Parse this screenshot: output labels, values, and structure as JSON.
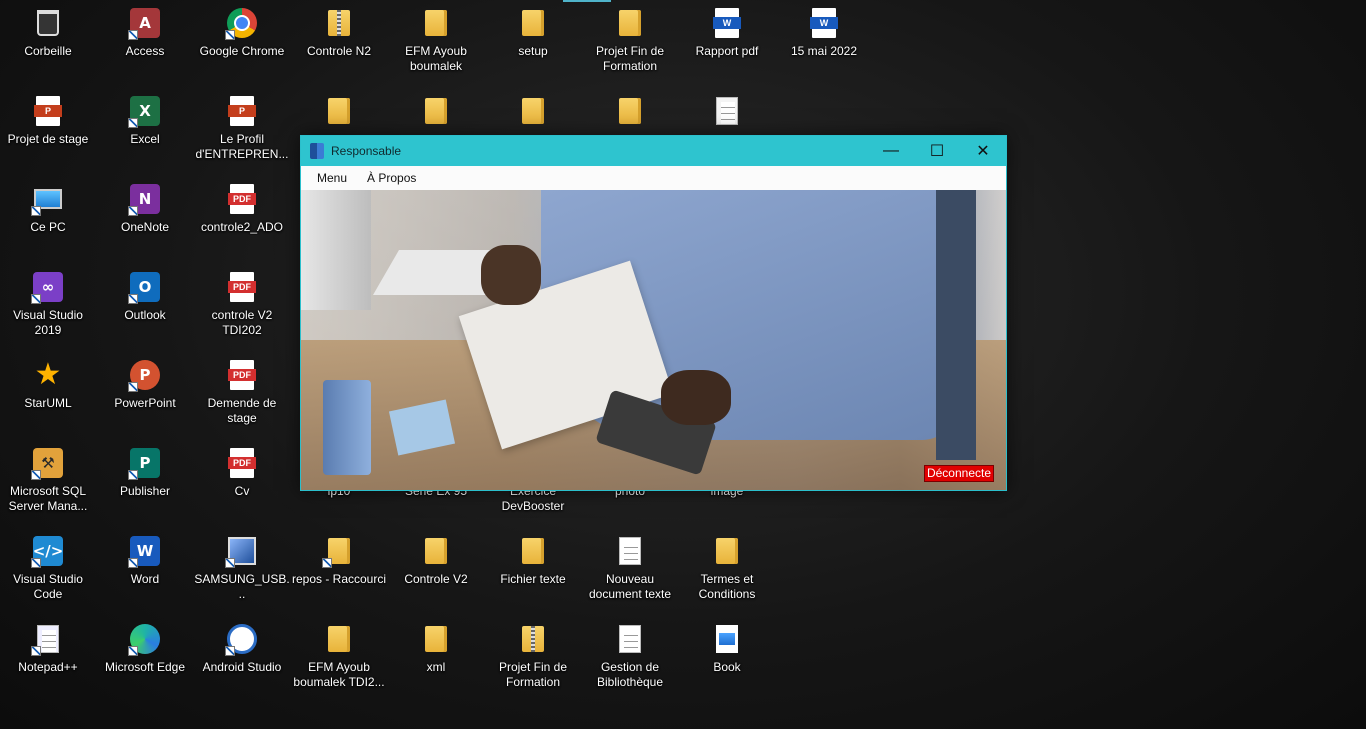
{
  "desktop_icons": [
    {
      "label": "Corbeille",
      "icon": "recycle-bin-icon"
    },
    {
      "label": "Access",
      "icon": "access-icon"
    },
    {
      "label": "Google Chrome",
      "icon": "chrome-icon"
    },
    {
      "label": "Controle N2",
      "icon": "zip-folder-icon"
    },
    {
      "label": "EFM Ayoub boumalek",
      "icon": "folder-icon"
    },
    {
      "label": "setup",
      "icon": "folder-icon"
    },
    {
      "label": "Projet Fin de Formation",
      "icon": "folder-icon"
    },
    {
      "label": "Rapport pdf",
      "icon": "word-icon"
    },
    {
      "label": "15 mai 2022",
      "icon": "word-icon"
    },
    {
      "label": "Projet de stage",
      "icon": "powerpoint-icon"
    },
    {
      "label": "Excel",
      "icon": "excel-icon"
    },
    {
      "label": "Le Profil d'ENTREPREN...",
      "icon": "powerpoint-icon"
    },
    {
      "label": "Ce PC",
      "icon": "this-pc-icon"
    },
    {
      "label": "OneNote",
      "icon": "onenote-icon"
    },
    {
      "label": "controle2_ADO",
      "icon": "pdf-icon"
    },
    {
      "label": "Visual Studio 2019",
      "icon": "visual-studio-icon"
    },
    {
      "label": "Outlook",
      "icon": "outlook-icon"
    },
    {
      "label": "controle V2 TDI202",
      "icon": "pdf-icon"
    },
    {
      "label": "StarUML",
      "icon": "staruml-icon"
    },
    {
      "label": "PowerPoint",
      "icon": "powerpoint-icon"
    },
    {
      "label": "Demende de stage",
      "icon": "pdf-icon"
    },
    {
      "label": "Microsoft SQL Server Mana...",
      "icon": "sql-server-icon"
    },
    {
      "label": "Publisher",
      "icon": "publisher-icon"
    },
    {
      "label": "Cv",
      "icon": "pdf-icon"
    },
    {
      "label": "Visual Studio Code",
      "icon": "vscode-icon"
    },
    {
      "label": "Word",
      "icon": "word-icon"
    },
    {
      "label": "SAMSUNG_USB...",
      "icon": "installer-icon"
    },
    {
      "label": "repos - Raccourci",
      "icon": "folder-icon"
    },
    {
      "label": "Controle V2",
      "icon": "folder-icon"
    },
    {
      "label": "Fichier texte",
      "icon": "folder-icon"
    },
    {
      "label": "Nouveau document texte",
      "icon": "text-file-icon"
    },
    {
      "label": "Termes et Conditions",
      "icon": "folder-icon"
    },
    {
      "label": "Notepad++",
      "icon": "notepadpp-icon"
    },
    {
      "label": "Microsoft Edge",
      "icon": "edge-icon"
    },
    {
      "label": "Android Studio",
      "icon": "android-studio-icon"
    },
    {
      "label": "EFM Ayoub boumalek TDI2...",
      "icon": "folder-icon"
    },
    {
      "label": "xml",
      "icon": "folder-icon"
    },
    {
      "label": "Projet Fin de Formation",
      "icon": "zip-folder-icon"
    },
    {
      "label": "Gestion de Bibliothèque",
      "icon": "text-file-icon"
    },
    {
      "label": "Book",
      "icon": "image-file-icon"
    },
    {
      "label": "lp10",
      "icon": "folder-icon"
    },
    {
      "label": "Serie Ex 95",
      "icon": "folder-icon"
    },
    {
      "label": "Exercice DevBooster",
      "icon": "folder-icon"
    },
    {
      "label": "photo",
      "icon": "folder-icon"
    },
    {
      "label": "image",
      "icon": "folder-icon"
    }
  ],
  "window": {
    "title": "Responsable",
    "minimize_glyph": "—",
    "maximize_glyph": "☐",
    "close_glyph": "✕",
    "menu": [
      "Menu",
      "À Propos"
    ],
    "deconnect_label": "Déconnecte"
  }
}
